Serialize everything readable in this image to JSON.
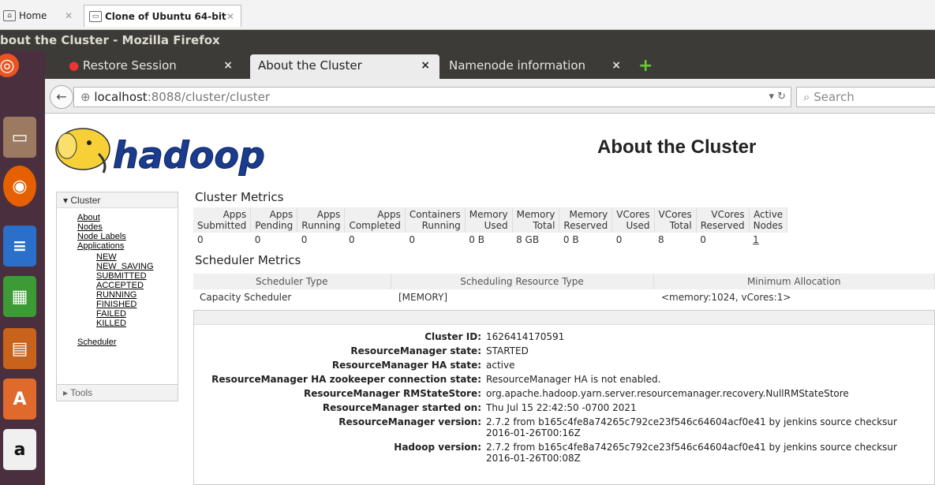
{
  "vm_tabs": {
    "home": "Home",
    "ubuntu": "Clone of Ubuntu 64-bit"
  },
  "window_title": "bout the Cluster - Mozilla Firefox",
  "firefox_tabs": [
    {
      "label": "Restore Session"
    },
    {
      "label": "About the Cluster"
    },
    {
      "label": "Namenode information"
    }
  ],
  "url": {
    "host": "localhost",
    "rest": ":8088/cluster/cluster"
  },
  "search_placeholder": "Search",
  "page_title": "About the Cluster",
  "logo_text": "hadoop",
  "sidebar": {
    "cluster_header": "Cluster",
    "links": [
      "About",
      "Nodes",
      "Node Labels",
      "Applications"
    ],
    "app_states": [
      "NEW",
      "NEW_SAVING",
      "SUBMITTED",
      "ACCEPTED",
      "RUNNING",
      "FINISHED",
      "FAILED",
      "KILLED"
    ],
    "scheduler": "Scheduler",
    "tools_header": "Tools"
  },
  "cluster_metrics": {
    "title": "Cluster Metrics",
    "headers": [
      "Apps\nSubmitted",
      "Apps\nPending",
      "Apps\nRunning",
      "Apps\nCompleted",
      "Containers\nRunning",
      "Memory\nUsed",
      "Memory\nTotal",
      "Memory\nReserved",
      "VCores\nUsed",
      "VCores\nTotal",
      "VCores\nReserved",
      "Active\nNodes"
    ],
    "values": [
      "0",
      "0",
      "0",
      "0",
      "0",
      "0 B",
      "8 GB",
      "0 B",
      "0",
      "8",
      "0",
      "1"
    ]
  },
  "scheduler_metrics": {
    "title": "Scheduler Metrics",
    "headers": [
      "Scheduler Type",
      "Scheduling Resource Type",
      "Minimum Allocation"
    ],
    "values": [
      "Capacity Scheduler",
      "[MEMORY]",
      "<memory:1024, vCores:1>"
    ]
  },
  "info": [
    {
      "label": "Cluster ID:",
      "value": "1626414170591"
    },
    {
      "label": "ResourceManager state:",
      "value": "STARTED"
    },
    {
      "label": "ResourceManager HA state:",
      "value": "active"
    },
    {
      "label": "ResourceManager HA zookeeper connection state:",
      "value": "ResourceManager HA is not enabled."
    },
    {
      "label": "ResourceManager RMStateStore:",
      "value": "org.apache.hadoop.yarn.server.resourcemanager.recovery.NullRMStateStore"
    },
    {
      "label": "ResourceManager started on:",
      "value": "Thu Jul 15 22:42:50 -0700 2021"
    },
    {
      "label": "ResourceManager version:",
      "value": "2.7.2 from b165c4fe8a74265c792ce23f546c64604acf0e41 by jenkins source checksur",
      "value2": "2016-01-26T00:16Z"
    },
    {
      "label": "Hadoop version:",
      "value": "2.7.2 from b165c4fe8a74265c792ce23f546c64604acf0e41 by jenkins source checksur",
      "value2": "2016-01-26T00:08Z"
    }
  ],
  "colors": {
    "launcher_bg": "#4a2f3f",
    "titlebar_bg": "#3c3b37",
    "logo_blue": "#1a3c8e",
    "logo_yellow": "#f7d038"
  }
}
